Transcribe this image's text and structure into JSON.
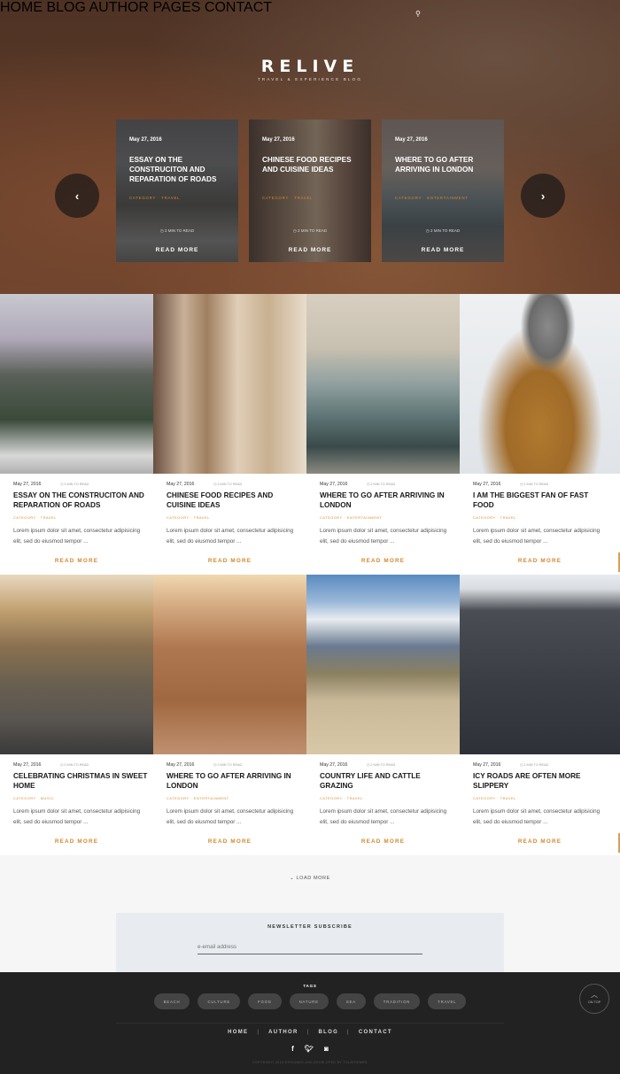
{
  "nav": {
    "items": [
      "HOME",
      "BLOG",
      "AUTHOR",
      "PAGES",
      "CONTACT"
    ],
    "search_icon": "search-icon"
  },
  "brand": {
    "logo": "RELIVE",
    "tagline": "TRAVEL & EXPERIENCE BLOG"
  },
  "slider": {
    "prev_icon": "chevron-left-icon",
    "next_icon": "chevron-right-icon",
    "slides": [
      {
        "date": "May 27, 2016",
        "title": "ESSAY ON THE CONSTRUCITON AND REPARATION OF ROADS",
        "category": "CATEGORY · TRAVEL",
        "read_time": "2 MIN TO READ",
        "more": "READ MORE"
      },
      {
        "date": "May 27, 2016",
        "title": "CHINESE FOOD RECIPES AND CUISINE IDEAS",
        "category": "CATEGORY · TRAVEL",
        "read_time": "2 MIN TO READ",
        "more": "READ MORE"
      },
      {
        "date": "May 27, 2016",
        "title": "WHERE TO GO AFTER ARRIVING IN LONDON",
        "category": "CATEGORY · ENTERTAINMENT",
        "read_time": "2 MIN TO READ",
        "more": "READ MORE"
      }
    ]
  },
  "posts": [
    {
      "date": "May 27, 2016",
      "read_time": "2 MIN TO READ",
      "title": "ESSAY ON THE CONSTRUCITON AND REPARATION OF ROADS",
      "category": "CATEGORY · TRAVEL",
      "excerpt": "Lorem ipsum dolor sit amet, consectetur adipisicing elit, sed do eiusmod tempor ...",
      "more": "READ MORE"
    },
    {
      "date": "May 27, 2016",
      "read_time": "2 MIN TO READ",
      "title": "CHINESE FOOD RECIPES AND CUISINE IDEAS",
      "category": "CATEGORY · TRAVEL",
      "excerpt": "Lorem ipsum dolor sit amet, consectetur adipisicing elit, sed do eiusmod tempor ...",
      "more": "READ MORE"
    },
    {
      "date": "May 27, 2016",
      "read_time": "2 MIN TO READ",
      "title": "WHERE TO GO AFTER ARRIVING IN LONDON",
      "category": "CATEGORY · ENTERTAINMENT",
      "excerpt": "Lorem ipsum dolor sit amet, consectetur adipisicing elit, sed do eiusmod tempor ...",
      "more": "READ MORE"
    },
    {
      "date": "May 27, 2016",
      "read_time": "2 MIN TO READ",
      "title": "I AM THE BIGGEST FAN OF FAST FOOD",
      "category": "CATEGORY · TRAVEL",
      "excerpt": "Lorem ipsum dolor sit amet, consectetur adipisicing elit, sed do eiusmod tempor ...",
      "more": "READ MORE"
    },
    {
      "date": "May 27, 2016",
      "read_time": "2 MIN TO READ",
      "title": "CELEBRATING CHRISTMAS IN SWEET HOME",
      "category": "CATEGORY · MUSIC",
      "excerpt": "Lorem ipsum dolor sit amet, consectetur adipisicing elit, sed do eiusmod tempor ...",
      "more": "READ MORE"
    },
    {
      "date": "May 27, 2016",
      "read_time": "2 MIN TO READ",
      "title": "WHERE TO GO AFTER ARRIVING IN LONDON",
      "category": "CATEGORY · ENTERTAINMENT",
      "excerpt": "Lorem ipsum dolor sit amet, consectetur adipisicing elit, sed do eiusmod tempor ...",
      "more": "READ MORE"
    },
    {
      "date": "May 27, 2016",
      "read_time": "2 MIN TO READ",
      "title": "COUNTRY LIFE AND CATTLE GRAZING",
      "category": "CATEGORY · TRAVEL",
      "excerpt": "Lorem ipsum dolor sit amet, consectetur adipisicing elit, sed do eiusmod tempor ...",
      "more": "READ MORE"
    },
    {
      "date": "May 27, 2016",
      "read_time": "2 MIN TO READ",
      "title": "ICY ROADS ARE OFTEN MORE SLIPPERY",
      "category": "CATEGORY · TRAVEL",
      "excerpt": "Lorem ipsum dolor sit amet, consectetur adipisicing elit, sed do eiusmod tempor ...",
      "more": "READ MORE"
    }
  ],
  "load_more": "LOAD MORE",
  "newsletter": {
    "title": "NEWSLETTER SUBSCRIBE",
    "placeholder": "e-email address"
  },
  "footer": {
    "tags_heading": "TAGS",
    "tags": [
      "BEACH",
      "CULTURE",
      "FOOD",
      "NATURE",
      "SEA",
      "TRADITION",
      "TRAVEL"
    ],
    "links": [
      "HOME",
      "AUTHOR",
      "BLOG",
      "CONTACT"
    ],
    "social": [
      "facebook-icon",
      "twitter-icon",
      "instagram-icon"
    ],
    "copyright": "COPYRIGHT 2016 DESIGNED AND DEVELOPED BY TOLATHEMES",
    "on_top": "ON TOP"
  },
  "colors": {
    "accent": "#d4882e",
    "footer_bg": "#222222",
    "newsletter_bg": "#e8ecf0"
  }
}
